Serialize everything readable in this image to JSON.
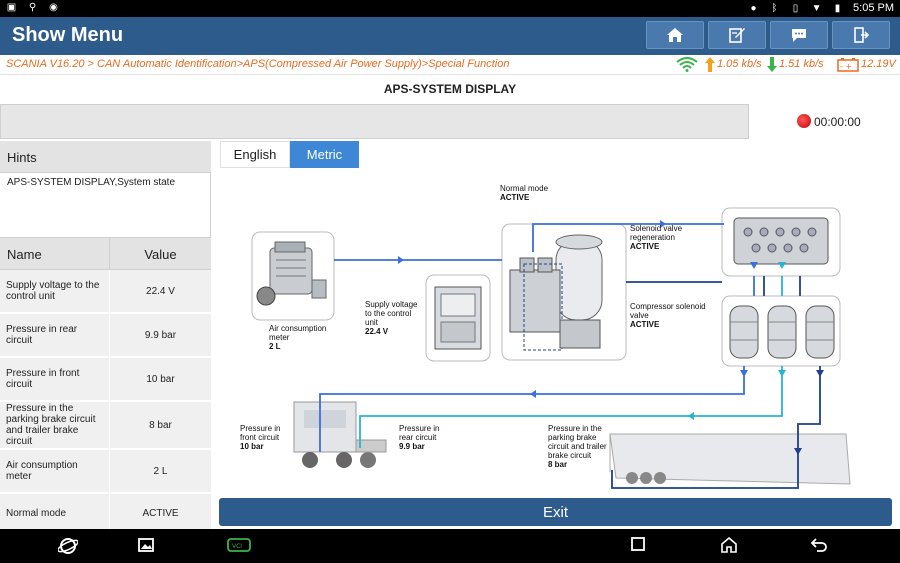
{
  "status_bar": {
    "time": "5:05 PM"
  },
  "header": {
    "title": "Show Menu",
    "buttons": [
      "home-icon",
      "edit-icon",
      "chat-icon",
      "exit-icon"
    ]
  },
  "breadcrumb": {
    "path": "SCANIA V16.20 > CAN Automatic Identification>APS(Compressed Air Power Supply)>Special Function",
    "upload_speed": "1.05 kb/s",
    "download_speed": "1.51 kb/s",
    "voltage": "12.19V"
  },
  "page_title": "APS-SYSTEM DISPLAY",
  "recording": {
    "timer": "00:00:00"
  },
  "hints": {
    "header": "Hints",
    "text": "APS-SYSTEM DISPLAY,System state"
  },
  "table": {
    "col_name": "Name",
    "col_value": "Value",
    "rows": [
      {
        "name": "Supply voltage to the control unit",
        "value": "22.4 V"
      },
      {
        "name": "Pressure in rear circuit",
        "value": "9.9 bar"
      },
      {
        "name": "Pressure in front circuit",
        "value": "10 bar"
      },
      {
        "name": "Pressure in the parking brake circuit and trailer brake circuit",
        "value": "8 bar"
      },
      {
        "name": "Air consumption meter",
        "value": "2 L"
      },
      {
        "name": "Normal mode",
        "value": "ACTIVE"
      }
    ]
  },
  "units": {
    "english": "English",
    "metric": "Metric",
    "selected": "Metric"
  },
  "diagram": {
    "normal_mode": {
      "label": "Normal mode",
      "value": "ACTIVE"
    },
    "solenoid_regen": {
      "label": "Solenoid valve regeneration",
      "value": "ACTIVE"
    },
    "compressor_solenoid": {
      "label": "Compressor solenoid valve",
      "value": "ACTIVE"
    },
    "supply_voltage": {
      "label": "Supply voltage to the control unit",
      "value": "22.4 V"
    },
    "air_meter": {
      "label": "Air consumption meter",
      "value": "2 L"
    },
    "front_circuit": {
      "label": "Pressure in front circuit",
      "value": "10 bar"
    },
    "rear_circuit": {
      "label": "Pressure in rear circuit",
      "value": "9.9 bar"
    },
    "parking_circuit": {
      "label": "Pressure in the parking brake circuit and trailer brake circuit",
      "value": "8 bar"
    }
  },
  "exit_label": "Exit",
  "colors": {
    "header": "#2d5b8c",
    "accent": "#3d87d6",
    "crumb": "#e86b1f",
    "dark_line": "#1f3f8f",
    "mid_line": "#3a6fe0",
    "light_line": "#27b3d6"
  }
}
